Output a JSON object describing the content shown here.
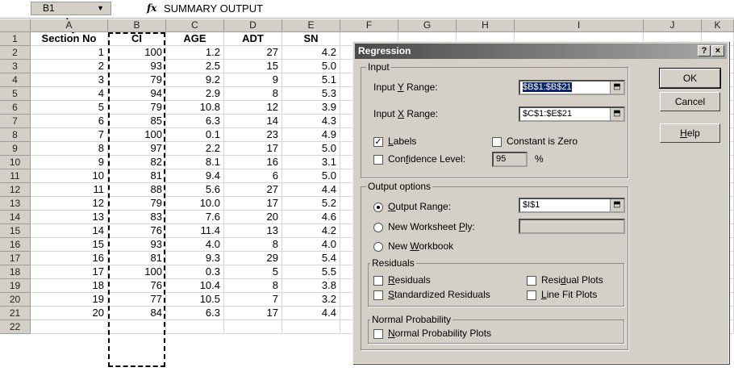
{
  "formula_bar": {
    "name_box": "B1",
    "dropdown_icon": "▼",
    "fx": "fx",
    "formula": "SUMMARY OUTPUT"
  },
  "columns": [
    "A",
    "B",
    "C",
    "D",
    "E",
    "F",
    "G",
    "H",
    "I",
    "J",
    "K"
  ],
  "headers": [
    "Section No",
    "CI",
    "AGE",
    "ADT",
    "SN"
  ],
  "rows": [
    [
      "1",
      "100",
      "1.2",
      "27",
      "4.2"
    ],
    [
      "2",
      "93",
      "2.5",
      "15",
      "5.0"
    ],
    [
      "3",
      "79",
      "9.2",
      "9",
      "5.1"
    ],
    [
      "4",
      "94",
      "2.9",
      "8",
      "5.3"
    ],
    [
      "5",
      "79",
      "10.8",
      "12",
      "3.9"
    ],
    [
      "6",
      "85",
      "6.3",
      "14",
      "4.3"
    ],
    [
      "7",
      "100",
      "0.1",
      "23",
      "4.9"
    ],
    [
      "8",
      "97",
      "2.2",
      "17",
      "5.0"
    ],
    [
      "9",
      "82",
      "8.1",
      "16",
      "3.1"
    ],
    [
      "10",
      "81",
      "9.4",
      "6",
      "5.0"
    ],
    [
      "11",
      "88",
      "5.6",
      "27",
      "4.4"
    ],
    [
      "12",
      "79",
      "10.0",
      "17",
      "5.2"
    ],
    [
      "13",
      "83",
      "7.6",
      "20",
      "4.6"
    ],
    [
      "14",
      "76",
      "11.4",
      "13",
      "4.2"
    ],
    [
      "15",
      "93",
      "4.0",
      "8",
      "4.0"
    ],
    [
      "16",
      "81",
      "9.3",
      "29",
      "5.4"
    ],
    [
      "17",
      "100",
      "0.3",
      "5",
      "5.5"
    ],
    [
      "18",
      "76",
      "10.4",
      "8",
      "3.8"
    ],
    [
      "19",
      "77",
      "10.5",
      "7",
      "3.2"
    ],
    [
      "20",
      "84",
      "6.3",
      "17",
      "4.4"
    ]
  ],
  "row_numbers": [
    "1",
    "2",
    "3",
    "4",
    "5",
    "6",
    "7",
    "8",
    "9",
    "10",
    "11",
    "12",
    "13",
    "14",
    "15",
    "16",
    "17",
    "18",
    "19",
    "20",
    "21",
    "22"
  ],
  "dialog": {
    "title": "Regression",
    "help_btn": "?",
    "close_btn": "×",
    "input_group": "Input",
    "y_range_label_pre": "Input ",
    "y_range_label_u": "Y",
    "y_range_label_post": " Range:",
    "y_range_value": "$B$1:$B$21",
    "x_range_label_pre": "Input ",
    "x_range_label_u": "X",
    "x_range_label_post": " Range:",
    "x_range_value": "$C$1:$E$21",
    "labels_u": "L",
    "labels_rest": "abels",
    "constant_zero": "Constant is Zero",
    "confidence_pre": "Con",
    "confidence_u": "f",
    "confidence_post": "idence Level:",
    "confidence_value": "95",
    "percent": "%",
    "output_group": "Output options",
    "output_range_u": "O",
    "output_range_rest": "utput Range:",
    "output_range_value": "$I$1",
    "new_ws_pre": "New Worksheet ",
    "new_ws_u": "P",
    "new_ws_post": "ly:",
    "new_wb_pre": "New ",
    "new_wb_u": "W",
    "new_wb_post": "orkbook",
    "residuals_group": "Residuals",
    "residuals_u": "R",
    "residuals_rest": "esiduals",
    "std_residuals_u": "S",
    "std_residuals_rest": "tandardized Residuals",
    "residual_plots_pre": "Resi",
    "residual_plots_u": "d",
    "residual_plots_post": "ual Plots",
    "line_fit_u": "L",
    "line_fit_rest": "ine Fit Plots",
    "normal_group": "Normal Probability",
    "normal_plots_u": "N",
    "normal_plots_rest": "ormal Probability Plots",
    "ok": "OK",
    "cancel": "Cancel",
    "help_u": "H",
    "help_rest": "elp",
    "check_mark": "✓",
    "range_btn_icon": "⬒"
  }
}
